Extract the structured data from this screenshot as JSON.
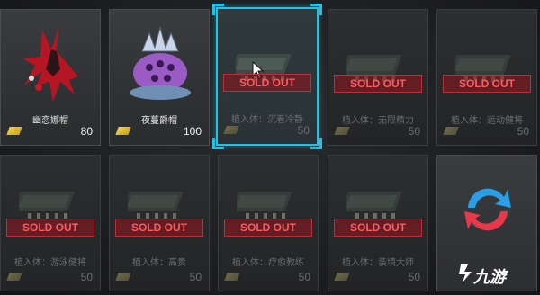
{
  "items": [
    {
      "name": "幽恋娜帽",
      "price": "80",
      "sold_out": false
    },
    {
      "name": "夜蔓爵帽",
      "price": "100",
      "sold_out": false
    },
    {
      "name": "植入体：沉着冷静",
      "price": "50",
      "sold_out": true,
      "selected": true
    },
    {
      "name": "植入体：无限精力",
      "price": "50",
      "sold_out": true
    },
    {
      "name": "植入体：运动健将",
      "price": "50",
      "sold_out": true
    },
    {
      "name": "植入体：游泳健将",
      "price": "50",
      "sold_out": true
    },
    {
      "name": "植入体：高贵",
      "price": "50",
      "sold_out": true
    },
    {
      "name": "植入体：疗愈教练",
      "price": "50",
      "sold_out": true
    },
    {
      "name": "植入体：装填大师",
      "price": "50",
      "sold_out": true
    }
  ],
  "sold_out_label": "SOLD OUT",
  "refresh_icon": "refresh-icon",
  "watermark": "九游",
  "colors": {
    "selected_border": "#22c2e8",
    "sold_out_text": "#ff5a60",
    "gold": "#f2d24a"
  }
}
